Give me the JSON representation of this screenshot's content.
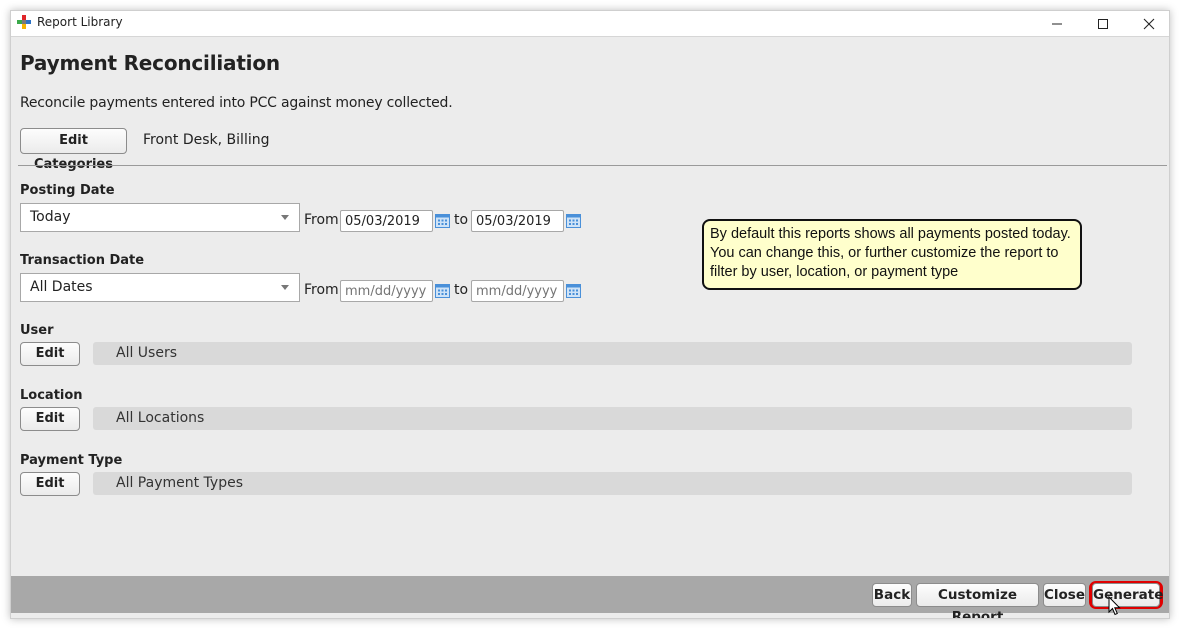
{
  "window": {
    "title": "Report Library",
    "controls": {
      "minimize": "minimize-icon",
      "maximize": "maximize-icon",
      "close": "close-icon"
    }
  },
  "report": {
    "title": "Payment Reconciliation",
    "description": "Reconcile payments entered into PCC against money collected.",
    "edit_categories_label": "Edit Categories",
    "categories": "Front Desk, Billing"
  },
  "posting_date": {
    "label": "Posting Date",
    "selected": "Today",
    "from_label": "From",
    "from_value": "05/03/2019",
    "to_label": "to",
    "to_value": "05/03/2019"
  },
  "transaction_date": {
    "label": "Transaction Date",
    "selected": "All Dates",
    "from_label": "From",
    "from_placeholder": "mm/dd/yyyy",
    "to_label": "to",
    "to_placeholder": "mm/dd/yyyy"
  },
  "filters": {
    "user": {
      "label": "User",
      "edit_label": "Edit",
      "value": "All Users"
    },
    "location": {
      "label": "Location",
      "edit_label": "Edit",
      "value": "All Locations"
    },
    "payment_type": {
      "label": "Payment Type",
      "edit_label": "Edit",
      "value": "All Payment Types"
    }
  },
  "callout": {
    "text": "By default this reports shows all payments posted today. You can change this, or further customize the report to filter by user, location, or payment type"
  },
  "footer": {
    "back": "Back",
    "customize": "Customize Report",
    "close": "Close",
    "generate": "Generate"
  },
  "colors": {
    "highlight": "#e00000",
    "callout_bg": "#ffffcc",
    "footer_bg": "#a8a8a8",
    "calendar_icon": "#4a90d9"
  }
}
